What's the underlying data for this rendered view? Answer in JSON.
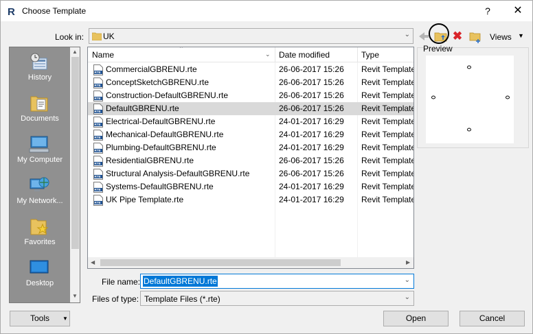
{
  "window": {
    "title": "Choose Template",
    "help_label": "?",
    "close_label": "✕"
  },
  "toolbar": {
    "look_in_label": "Look in:",
    "look_in_value": "UK",
    "views_label": "Views"
  },
  "places": [
    {
      "label": "History",
      "icon": "history-icon"
    },
    {
      "label": "Documents",
      "icon": "documents-icon"
    },
    {
      "label": "My Computer",
      "icon": "computer-icon"
    },
    {
      "label": "My Network...",
      "icon": "network-icon"
    },
    {
      "label": "Favorites",
      "icon": "favorites-icon"
    },
    {
      "label": "Desktop",
      "icon": "desktop-icon"
    }
  ],
  "file_list": {
    "columns": [
      "Name",
      "Date modified",
      "Type"
    ],
    "rows": [
      {
        "name": "CommercialGBRENU.rte",
        "date": "26-06-2017 15:26",
        "type": "Revit Template",
        "selected": false
      },
      {
        "name": "ConceptSketchGBRENU.rte",
        "date": "26-06-2017 15:26",
        "type": "Revit Template",
        "selected": false
      },
      {
        "name": "Construction-DefaultGBRENU.rte",
        "date": "26-06-2017 15:26",
        "type": "Revit Template",
        "selected": false
      },
      {
        "name": "DefaultGBRENU.rte",
        "date": "26-06-2017 15:26",
        "type": "Revit Template",
        "selected": true
      },
      {
        "name": "Electrical-DefaultGBRENU.rte",
        "date": "24-01-2017 16:29",
        "type": "Revit Template",
        "selected": false
      },
      {
        "name": "Mechanical-DefaultGBRENU.rte",
        "date": "24-01-2017 16:29",
        "type": "Revit Template",
        "selected": false
      },
      {
        "name": "Plumbing-DefaultGBRENU.rte",
        "date": "24-01-2017 16:29",
        "type": "Revit Template",
        "selected": false
      },
      {
        "name": "ResidentialGBRENU.rte",
        "date": "26-06-2017 15:26",
        "type": "Revit Template",
        "selected": false
      },
      {
        "name": "Structural Analysis-DefaultGBRENU.rte",
        "date": "26-06-2017 15:26",
        "type": "Revit Template",
        "selected": false
      },
      {
        "name": "Systems-DefaultGBRENU.rte",
        "date": "24-01-2017 16:29",
        "type": "Revit Template",
        "selected": false
      },
      {
        "name": "UK Pipe Template.rte",
        "date": "24-01-2017 16:29",
        "type": "Revit Template",
        "selected": false
      }
    ]
  },
  "preview": {
    "label": "Preview"
  },
  "file_name": {
    "label": "File name:",
    "value": "DefaultGBRENU.rte"
  },
  "file_type": {
    "label": "Files of type:",
    "value": "Template Files  (*.rte)"
  },
  "buttons": {
    "tools": "Tools",
    "open": "Open",
    "cancel": "Cancel"
  },
  "colors": {
    "accent": "#0078d7",
    "places_bg": "#909090",
    "selected_row": "#d9d9d9",
    "delete_red": "#d9242a",
    "folder_yellow": "#e8c25e"
  }
}
